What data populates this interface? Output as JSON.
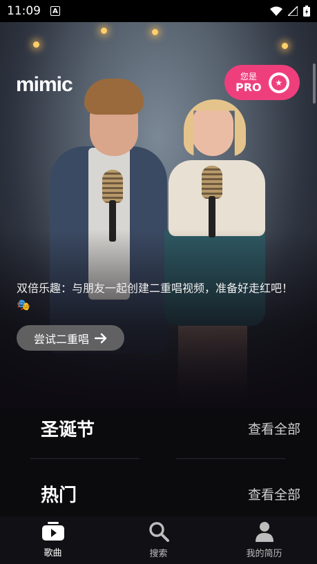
{
  "status_bar": {
    "time": "11:09",
    "a_icon_letter": "A"
  },
  "header": {
    "logo": "mimic",
    "pro_line1": "您是",
    "pro_line2": "PRO"
  },
  "promo": {
    "text": "双倍乐趣：与朋友一起创建二重唱视频，准备好走红吧！🎭",
    "button_label": "尝试二重唱"
  },
  "sections": [
    {
      "title": "圣诞节",
      "see_all": "查看全部"
    },
    {
      "title": "热门",
      "see_all": "查看全部"
    }
  ],
  "nav": [
    {
      "label": "歌曲",
      "icon": "play-icon",
      "active": true
    },
    {
      "label": "搜索",
      "icon": "search-icon",
      "active": false
    },
    {
      "label": "我的简历",
      "icon": "profile-icon",
      "active": false
    }
  ],
  "colors": {
    "pro_pink": "#ee3f7c",
    "background": "#0b0b0e"
  }
}
